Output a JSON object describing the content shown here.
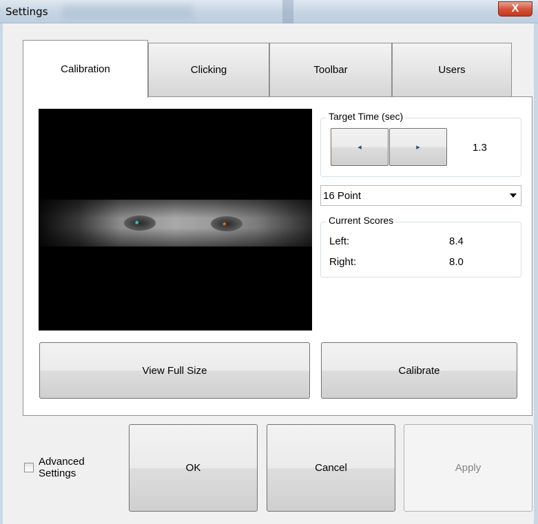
{
  "window": {
    "title": "Settings",
    "close_glyph": "X"
  },
  "tabs": [
    {
      "label": "Calibration",
      "active": true
    },
    {
      "label": "Clicking",
      "active": false
    },
    {
      "label": "Toolbar",
      "active": false
    },
    {
      "label": "Users",
      "active": false
    }
  ],
  "calibration": {
    "target_time": {
      "label": "Target Time (sec)",
      "decrease_glyph": "◂",
      "increase_glyph": "▸",
      "value": "1.3"
    },
    "point_mode": {
      "selected": "16 Point"
    },
    "scores": {
      "label": "Current Scores",
      "left_label": "Left:",
      "left_value": "8.4",
      "right_label": "Right:",
      "right_value": "8.0"
    },
    "markers": {
      "left_glyph": "*",
      "right_glyph": "*",
      "left_color": "#3fd6e0",
      "right_color": "#f07020"
    },
    "view_full_size_label": "View Full Size",
    "calibrate_label": "Calibrate"
  },
  "footer": {
    "advanced_settings_label_line1": "Advanced",
    "advanced_settings_label_line2": "Settings",
    "advanced_settings_checked": false,
    "ok_label": "OK",
    "cancel_label": "Cancel",
    "apply_label": "Apply"
  }
}
